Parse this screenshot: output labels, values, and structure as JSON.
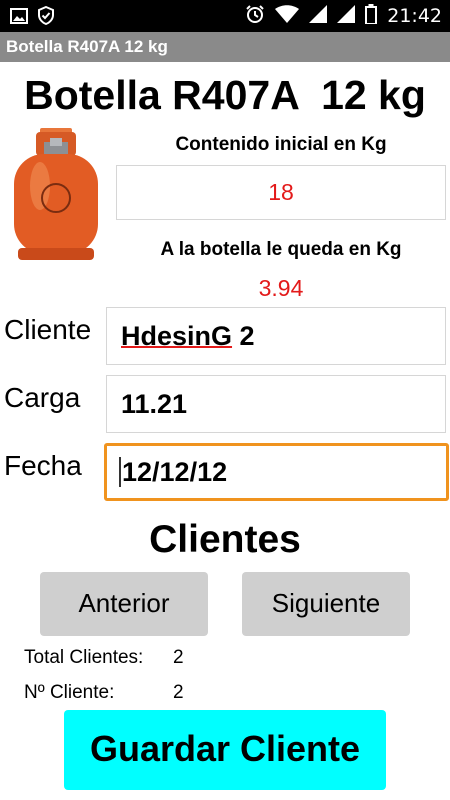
{
  "status_bar": {
    "time": "21:42"
  },
  "title_bar": {
    "title": "Botella R407A 12 kg"
  },
  "header": {
    "title": "Botella R407A  12 kg"
  },
  "initial": {
    "label": "Contenido inicial en Kg",
    "value": "18"
  },
  "remaining": {
    "label": "A la botella le queda en Kg",
    "value": "3.94"
  },
  "form": {
    "cliente_label": "Cliente",
    "cliente_word": "HdesinG",
    "cliente_num": " 2",
    "carga_label": "Carga",
    "carga_value": "11.21",
    "fecha_label": "Fecha",
    "fecha_value": "12/12/12"
  },
  "clients": {
    "title": "Clientes",
    "prev_label": "Anterior",
    "next_label": "Siguiente",
    "total_label": "Total Clientes:",
    "total_value": "2",
    "number_label": "Nº Cliente:",
    "number_value": "2"
  },
  "save_label": "Guardar Cliente",
  "colors": {
    "value_red": "#e31a1a",
    "save_cyan": "#00ffff",
    "focus_orange": "#f0931e"
  }
}
